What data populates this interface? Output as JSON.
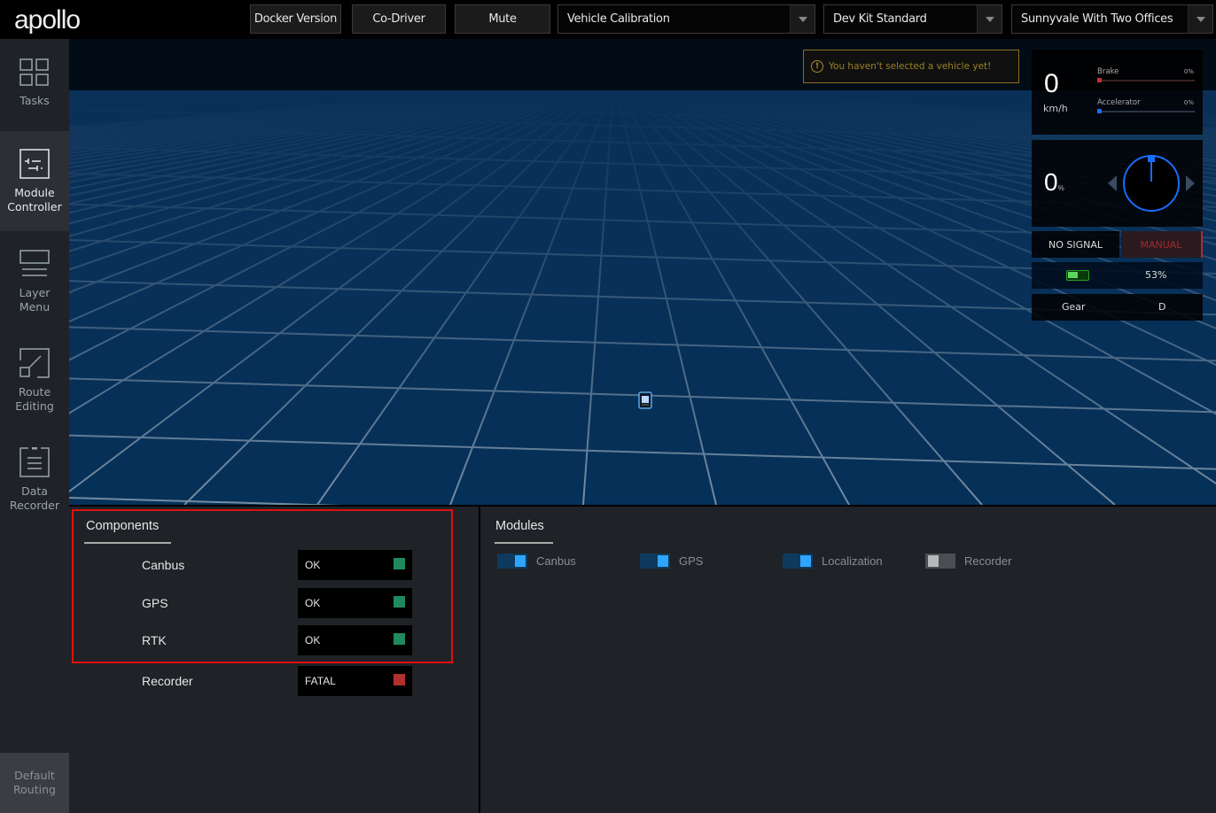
{
  "header": {
    "logo": "apollo",
    "buttons": [
      "Docker Version",
      "Co-Driver",
      "Mute"
    ],
    "selects": [
      {
        "name": "mode",
        "value": "Vehicle Calibration"
      },
      {
        "name": "vehicle",
        "value": "Dev Kit Standard"
      },
      {
        "name": "map",
        "value": "Sunnyvale With Two Offices"
      }
    ]
  },
  "sidebar": {
    "items": [
      {
        "id": "tasks",
        "label_lines": [
          "Tasks"
        ],
        "icon": "grid-icon",
        "active": false
      },
      {
        "id": "module-controller",
        "label_lines": [
          "Module",
          "Controller"
        ],
        "icon": "sliders-icon",
        "active": true
      },
      {
        "id": "layer-menu",
        "label_lines": [
          "Layer",
          "Menu"
        ],
        "icon": "layers-icon",
        "active": false
      },
      {
        "id": "route-editing",
        "label_lines": [
          "Route",
          "Editing"
        ],
        "icon": "route-icon",
        "active": false
      },
      {
        "id": "data-recorder",
        "label_lines": [
          "Data",
          "Recorder"
        ],
        "icon": "clipboard-icon",
        "active": false
      }
    ],
    "default_routing": [
      "Default",
      "Routing"
    ]
  },
  "scene": {
    "warning": "You haven't selected a vehicle yet!",
    "warning_icon": "!",
    "dashboard": {
      "speed": "0",
      "speed_unit": "km/h",
      "brake_label": "Brake",
      "brake_pct": "0%",
      "brake_value": 0,
      "accelerator_label": "Accelerator",
      "accelerator_pct": "0%",
      "accelerator_value": 0,
      "steering": "0",
      "steering_unit": "%",
      "signal": "NO SIGNAL",
      "drive_mode": "MANUAL",
      "battery_pct": "53%",
      "battery_value": 0.53,
      "gear_label": "Gear",
      "gear_value": "D"
    },
    "colors": {
      "brake": "#c0302f",
      "accelerator": "#1a6cff",
      "ok": "#1f8a5e",
      "fatal": "#b3302f",
      "toggle_on": "#30a5ff",
      "toggle_on_bg": "#0e3a5e"
    }
  },
  "components": {
    "title": "Components",
    "rows": [
      {
        "name": "Canbus",
        "status": "OK",
        "state": "ok"
      },
      {
        "name": "GPS",
        "status": "OK",
        "state": "ok"
      },
      {
        "name": "RTK",
        "status": "OK",
        "state": "ok"
      },
      {
        "name": "Recorder",
        "status": "FATAL",
        "state": "fatal"
      }
    ]
  },
  "modules": {
    "title": "Modules",
    "items": [
      {
        "name": "Canbus",
        "on": true
      },
      {
        "name": "GPS",
        "on": true
      },
      {
        "name": "Localization",
        "on": true
      },
      {
        "name": "Recorder",
        "on": false
      }
    ]
  }
}
